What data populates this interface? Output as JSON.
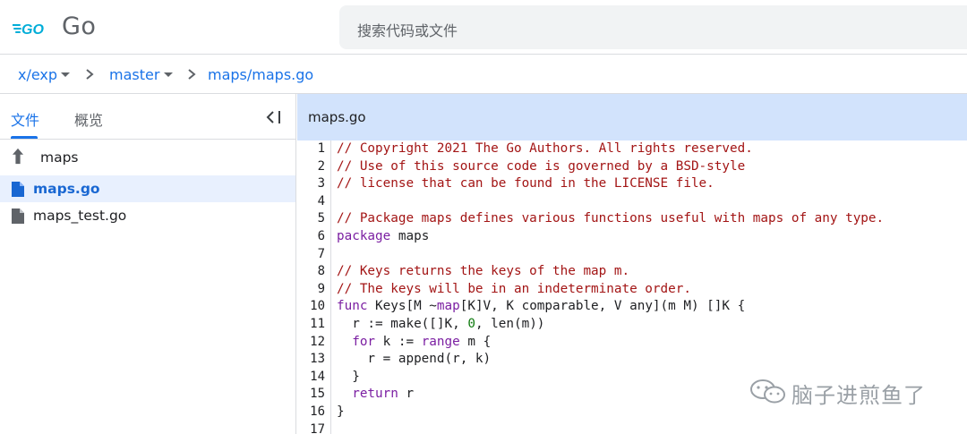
{
  "header": {
    "logo_text": "GO",
    "app_title": "Go",
    "search_placeholder": "搜索代码或文件"
  },
  "breadcrumb": {
    "repo": "x/exp",
    "branch": "master",
    "path": "maps/maps.go"
  },
  "sidebar": {
    "tabs": [
      "文件",
      "概览"
    ],
    "items": [
      {
        "label": "maps",
        "icon": "up-arrow-icon"
      },
      {
        "label": "maps.go",
        "icon": "file-icon",
        "selected": true
      },
      {
        "label": "maps_test.go",
        "icon": "file-icon"
      }
    ]
  },
  "editor": {
    "filename": "maps.go",
    "line_numbers": [
      "1",
      "2",
      "3",
      "4",
      "5",
      "6",
      "7",
      "8",
      "9",
      "10",
      "11",
      "12",
      "13",
      "14",
      "15",
      "16",
      "17"
    ]
  },
  "watermark": {
    "text": "脑子进煎鱼了"
  },
  "colors": {
    "accent": "#1a73e8",
    "comment": "#a31515",
    "keyword": "#7b1fa2",
    "number": "#0f7b0f",
    "code_header_bg": "#d2e3fc",
    "selected_bg": "#e8f0fe"
  }
}
